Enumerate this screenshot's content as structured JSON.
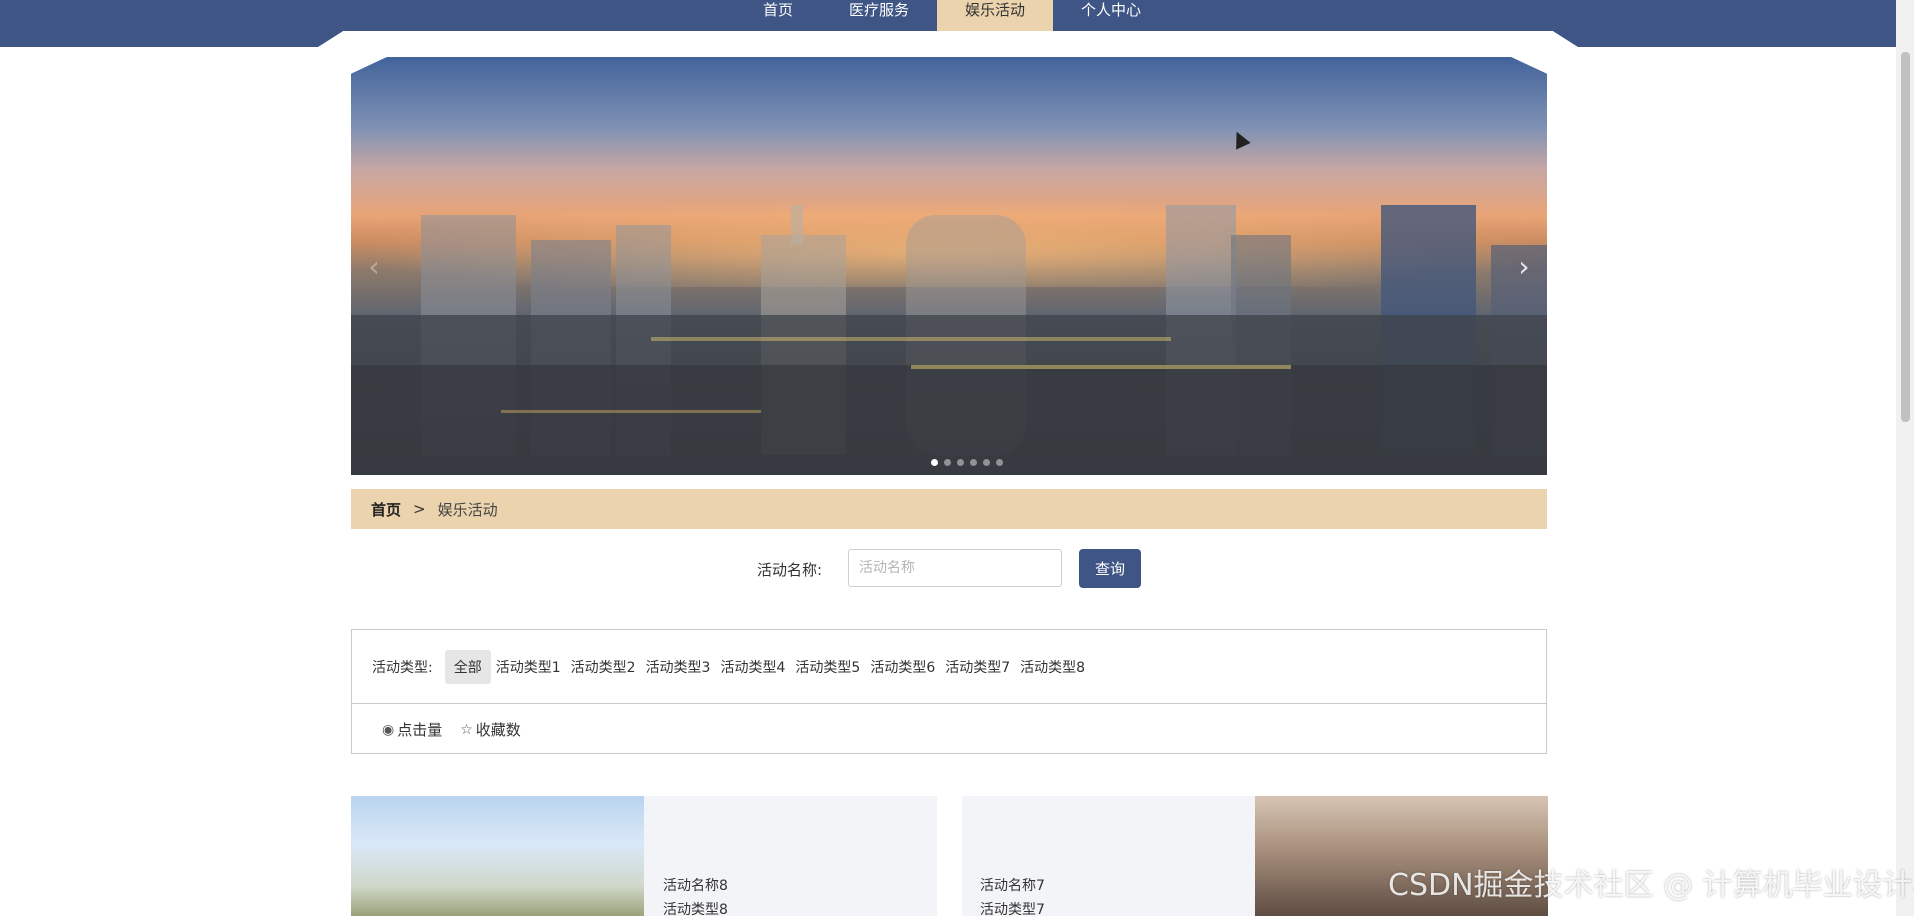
{
  "nav": {
    "items": [
      {
        "label": "首页"
      },
      {
        "label": "医疗服务"
      },
      {
        "label": "娱乐活动"
      },
      {
        "label": "个人中心"
      }
    ],
    "active_index": 2,
    "bar_color": "#3e5585",
    "active_color": "#ebd3ad"
  },
  "banner": {
    "prev_icon": "chevron-left-icon",
    "next_icon": "chevron-right-icon",
    "slides": 6,
    "active_slide": 0
  },
  "breadcrumb": {
    "home": "首页",
    "separator": ">",
    "current": "娱乐活动"
  },
  "search": {
    "label": "活动名称:",
    "placeholder": "活动名称",
    "value": "",
    "button": "查询"
  },
  "filter": {
    "type_label": "活动类型:",
    "types": [
      "全部",
      "活动类型1",
      "活动类型2",
      "活动类型3",
      "活动类型4",
      "活动类型5",
      "活动类型6",
      "活动类型7",
      "活动类型8"
    ],
    "active_type": 0,
    "sorts": [
      {
        "icon": "eye-icon",
        "label": "点击量"
      },
      {
        "icon": "star-icon",
        "label": "收藏数"
      }
    ]
  },
  "cards": [
    {
      "name": "活动名称8",
      "type": "活动类型8"
    },
    {
      "name": "活动名称7",
      "type": "活动类型7"
    }
  ],
  "watermark": "CSDN掘金技术社区 @ 计算机毕业设计小明哥"
}
